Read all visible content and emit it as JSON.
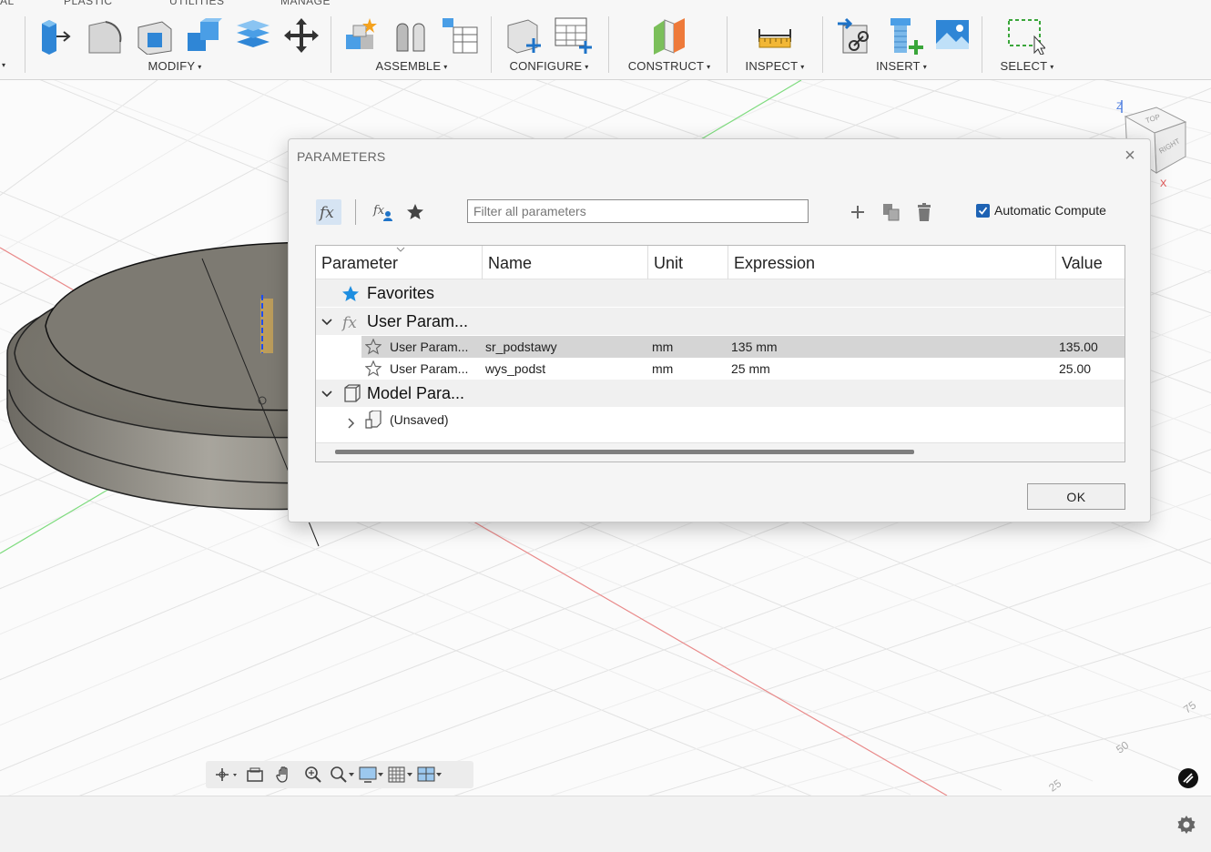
{
  "toolbar": {
    "tabs": [
      "AL",
      "PLASTIC",
      "UTILITIES",
      "MANAGE"
    ],
    "groups": {
      "modify": "MODIFY",
      "assemble": "ASSEMBLE",
      "configure": "CONFIGURE",
      "construct": "CONSTRUCT",
      "inspect": "INSPECT",
      "insert": "INSERT",
      "select": "SELECT"
    },
    "dropdown_glyph": "▾",
    "icons": {
      "modify": [
        "press-pull-icon",
        "fillet-icon",
        "shell-icon",
        "combine-icon",
        "offset-face-icon",
        "move-icon"
      ],
      "assemble": [
        "new-component-icon",
        "joint-icon",
        "bill-of-materials-icon"
      ],
      "configure": [
        "configure-model-icon",
        "configuration-table-icon"
      ],
      "construct": [
        "construct-plane-icon"
      ],
      "inspect": [
        "measure-icon"
      ],
      "insert": [
        "insert-derive-icon",
        "insert-mcmaster-icon",
        "insert-canvas-icon"
      ],
      "select": [
        "select-window-icon"
      ]
    }
  },
  "viewcube": {
    "top_label": "TOP",
    "right_label": "RIGHT",
    "z_axis": "Z",
    "x_axis": "X"
  },
  "grid_labels": [
    "75",
    "50",
    "25"
  ],
  "navbar": {
    "icons": [
      "orbit-icon",
      "look-at-icon",
      "pan-icon",
      "zoom-icon",
      "zoom-window-icon",
      "display-settings-icon",
      "grid-settings-icon",
      "viewports-icon"
    ]
  },
  "dialog": {
    "title": "PARAMETERS",
    "close_glyph": "×",
    "filter_placeholder": "Filter all parameters",
    "automatic_compute_label": "Automatic Compute",
    "automatic_compute_checked": true,
    "ok_label": "OK",
    "table": {
      "columns": [
        "Parameter",
        "Name",
        "Unit",
        "Expression",
        "Value"
      ],
      "groups": {
        "favorites": "Favorites",
        "user": "User Param...",
        "model": "Model Para..."
      },
      "user_params": [
        {
          "parameter": "User Param...",
          "name": "sr_podstawy",
          "unit": "mm",
          "expression": "135 mm",
          "value": "135.00",
          "selected": true
        },
        {
          "parameter": "User Param...",
          "name": "wys_podst",
          "unit": "mm",
          "expression": "25 mm",
          "value": "25.00",
          "selected": false
        }
      ],
      "model_children": [
        {
          "label": "(Unsaved)"
        }
      ]
    }
  },
  "colors": {
    "accent_blue": "#1e73c8",
    "checkbox_blue": "#1e63b4",
    "selected_row": "#d5d5d5",
    "axis_red": "#e05050",
    "axis_green": "#3bbf3b"
  }
}
